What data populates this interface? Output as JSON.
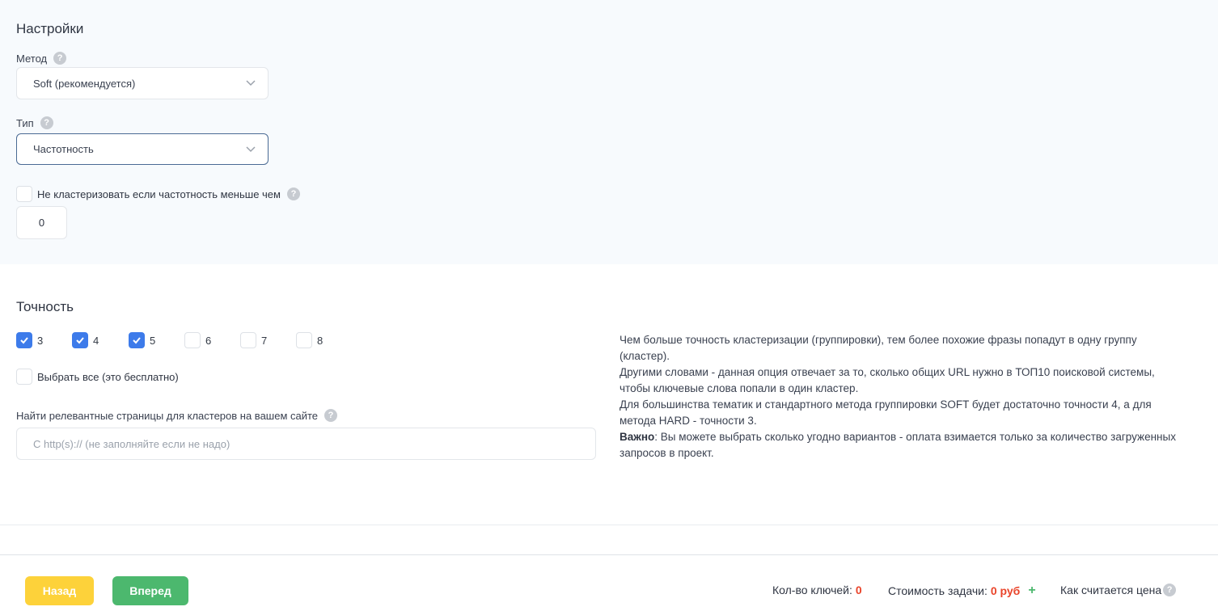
{
  "settings": {
    "title": "Настройки",
    "method_label": "Метод",
    "method_value": "Soft (рекомендуется)",
    "type_label": "Тип",
    "type_value": "Частотность",
    "no_cluster_label": "Не кластеризовать если частотность меньше чем",
    "no_cluster_value": "0"
  },
  "accuracy": {
    "title": "Точность",
    "options": [
      {
        "label": "3",
        "checked": true
      },
      {
        "label": "4",
        "checked": true
      },
      {
        "label": "5",
        "checked": true
      },
      {
        "label": "6",
        "checked": false
      },
      {
        "label": "7",
        "checked": false
      },
      {
        "label": "8",
        "checked": false
      }
    ],
    "select_all_label": "Выбрать все (это бесплатно)",
    "relevant_label": "Найти релевантные страницы для кластеров на вашем сайте",
    "url_placeholder": "С http(s):// (не заполняйте если не надо)",
    "info_p1": "Чем больше точность кластеризации (группировки), тем более похожие фразы попадут в одну группу (кластер).",
    "info_p2": "Другими словами - данная опция отвечает за то, сколько общих URL нужно в ТОП10 поисковой системы, чтобы ключевые слова попали в один кластер.",
    "info_p3": "Для большинства тематик и стандартного метода группировки SOFT будет достаточно точности 4, а для метода HARD - точности 3.",
    "info_bold": "Важно",
    "info_p4": ": Вы можете выбрать сколько угодно вариантов - оплата взимается только за количество загруженных запросов в проект."
  },
  "footer": {
    "back_label": "Назад",
    "next_label": "Вперед",
    "keys_label": "Кол-во ключей:",
    "keys_value": "0",
    "cost_label": "Стоимость задачи:",
    "cost_value": "0 руб",
    "plus": "+",
    "price_link": "Как считается цена"
  },
  "colors": {
    "accent_blue": "#3d7bea",
    "back_button": "#fdd23a",
    "next_button": "#4cb86e",
    "highlight_red": "#e9442a"
  }
}
